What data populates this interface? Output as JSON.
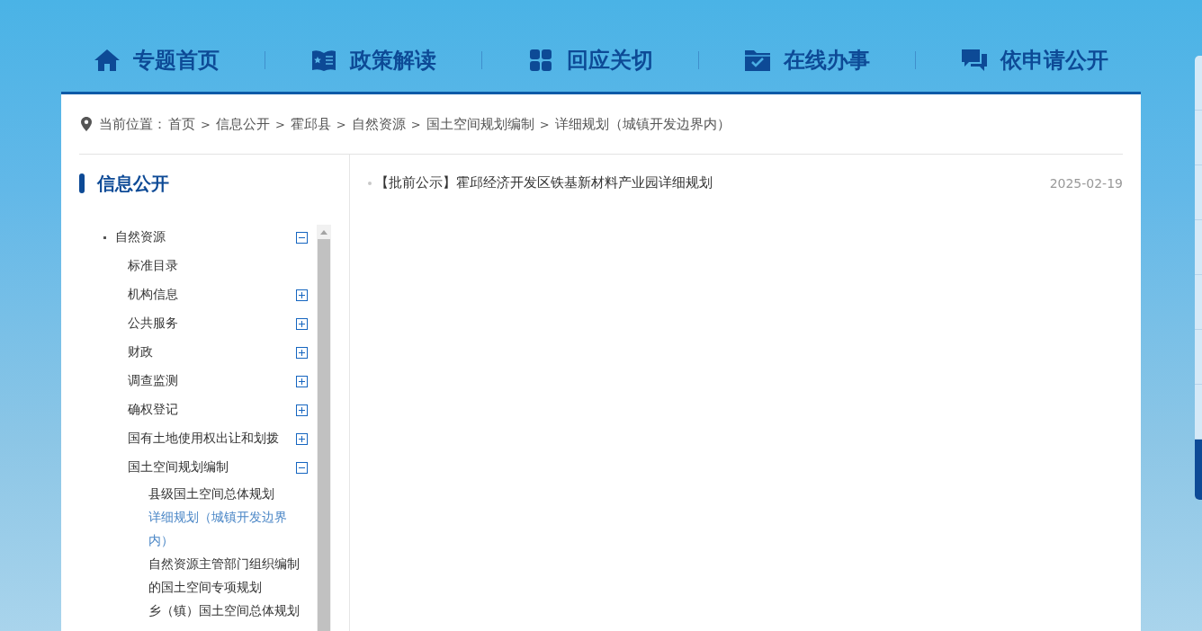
{
  "nav": [
    {
      "label": "专题首页",
      "kind": "home"
    },
    {
      "label": "政策解读",
      "kind": "book"
    },
    {
      "label": "回应关切",
      "kind": "grid"
    },
    {
      "label": "在线办事",
      "kind": "folder"
    },
    {
      "label": "依申请公开",
      "kind": "chat"
    }
  ],
  "breadcrumb": {
    "label": "当前位置：",
    "items": [
      "首页",
      "信息公开",
      "霍邱县",
      "自然资源",
      "国土空间规划编制",
      "详细规划（城镇开发边界内）"
    ],
    "separator": ">"
  },
  "sidebar": {
    "title": "信息公开",
    "tree": [
      {
        "label": "自然资源",
        "expanded": true,
        "children": [
          {
            "label": "标准目录",
            "kind": "leaf"
          },
          {
            "label": "机构信息",
            "kind": "group",
            "expanded": false
          },
          {
            "label": "公共服务",
            "kind": "group",
            "expanded": false
          },
          {
            "label": "财政",
            "kind": "group",
            "expanded": false
          },
          {
            "label": "调查监测",
            "kind": "group",
            "expanded": false
          },
          {
            "label": "确权登记",
            "kind": "group",
            "expanded": false
          },
          {
            "label": "国有土地使用权出让和划拨",
            "kind": "group",
            "expanded": false
          },
          {
            "label": "国土空间规划编制",
            "kind": "group",
            "expanded": true,
            "children": [
              {
                "label": "县级国土空间总体规划",
                "selected": false
              },
              {
                "label": "详细规划（城镇开发边界内）",
                "selected": true
              },
              {
                "label": "自然资源主管部门组织编制的国土空间专项规划",
                "selected": false
              },
              {
                "label": "乡（镇）国土空间总体规划",
                "selected": false
              }
            ]
          }
        ]
      }
    ]
  },
  "articles": [
    {
      "title": "【批前公示】霍邱经济开发区铁基新材料产业园详细规划",
      "date": "2025-02-19"
    }
  ]
}
